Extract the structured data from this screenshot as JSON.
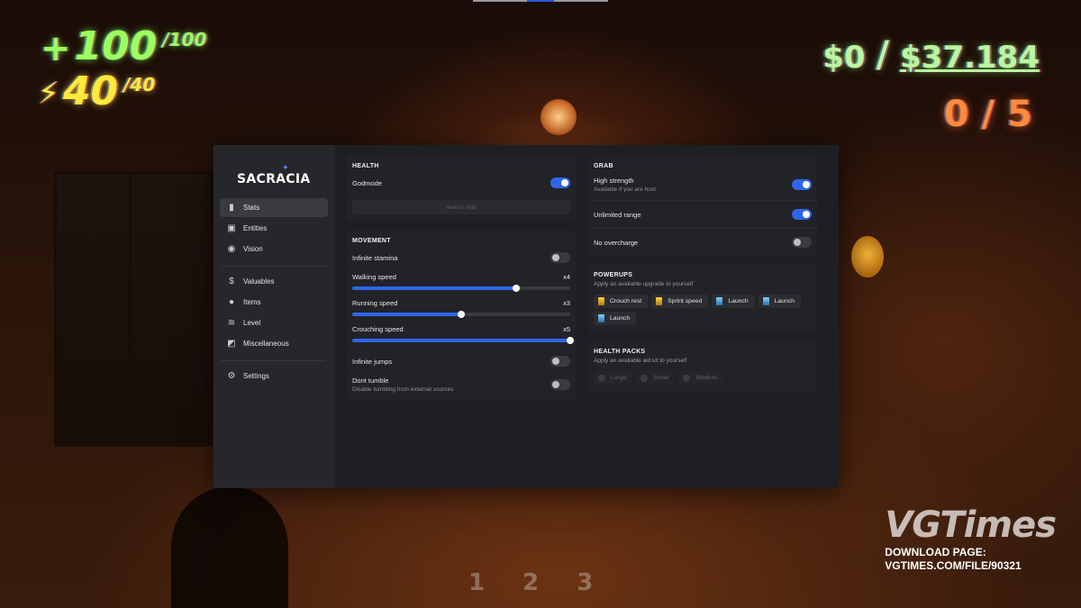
{
  "hud": {
    "health_icon": "+",
    "health": "100",
    "health_max": "/100",
    "energy_icon": "⚡",
    "energy": "40",
    "energy_max": "/40",
    "money": "$0",
    "money_sep": "/",
    "money_total": "$37.184",
    "goal": "0/5",
    "slots": [
      "1",
      "2",
      "3"
    ]
  },
  "watermark": {
    "logo": "VGTimes",
    "line1": "DOWNLOAD PAGE:",
    "line2": "VGTIMES.COM/FILE/90321"
  },
  "brand": "SACRACIA",
  "nav": {
    "stats": "Stats",
    "entities": "Entities",
    "vision": "Vision",
    "valuables": "Valuables",
    "items": "Items",
    "level": "Level",
    "miscellaneous": "Miscellaneous",
    "settings": "Settings"
  },
  "health": {
    "title": "HEALTH",
    "godmode": "Godmode",
    "godmode_on": true,
    "heal_button": "Heal to max"
  },
  "movement": {
    "title": "MOVEMENT",
    "infinite_stamina": "Infinite stamina",
    "infinite_stamina_on": false,
    "walking_speed": "Walking speed",
    "walking_value": "x4",
    "walking_fraction": 0.75,
    "running_speed": "Running speed",
    "running_value": "x3",
    "running_fraction": 0.5,
    "crouching_speed": "Crouching speed",
    "crouching_value": "x5",
    "crouching_fraction": 1.0,
    "infinite_jumps": "Infinite jumps",
    "infinite_jumps_on": false,
    "dont_tumble": "Dont tumble",
    "dont_tumble_sub": "Disable tumbling from external sources",
    "dont_tumble_on": false
  },
  "grab": {
    "title": "GRAB",
    "high_strength": "High strength",
    "high_strength_sub": "Available if you are host",
    "high_strength_on": true,
    "unlimited_range": "Unlimited range",
    "unlimited_range_on": true,
    "no_overcharge": "No overcharge",
    "no_overcharge_on": false
  },
  "powerups": {
    "title": "POWERUPS",
    "subtitle": "Apply an available upgrade to yourself",
    "items": [
      "Crouch rest",
      "Sprint speed",
      "Launch",
      "Launch",
      "Launch"
    ]
  },
  "health_packs": {
    "title": "HEALTH PACKS",
    "subtitle": "Apply an available aid kit to yourself",
    "items": [
      "Large",
      "Small",
      "Medium"
    ]
  },
  "colors": {
    "accent": "#2f66e8",
    "panel": "#1e1f22",
    "sidebar": "#26272b"
  }
}
